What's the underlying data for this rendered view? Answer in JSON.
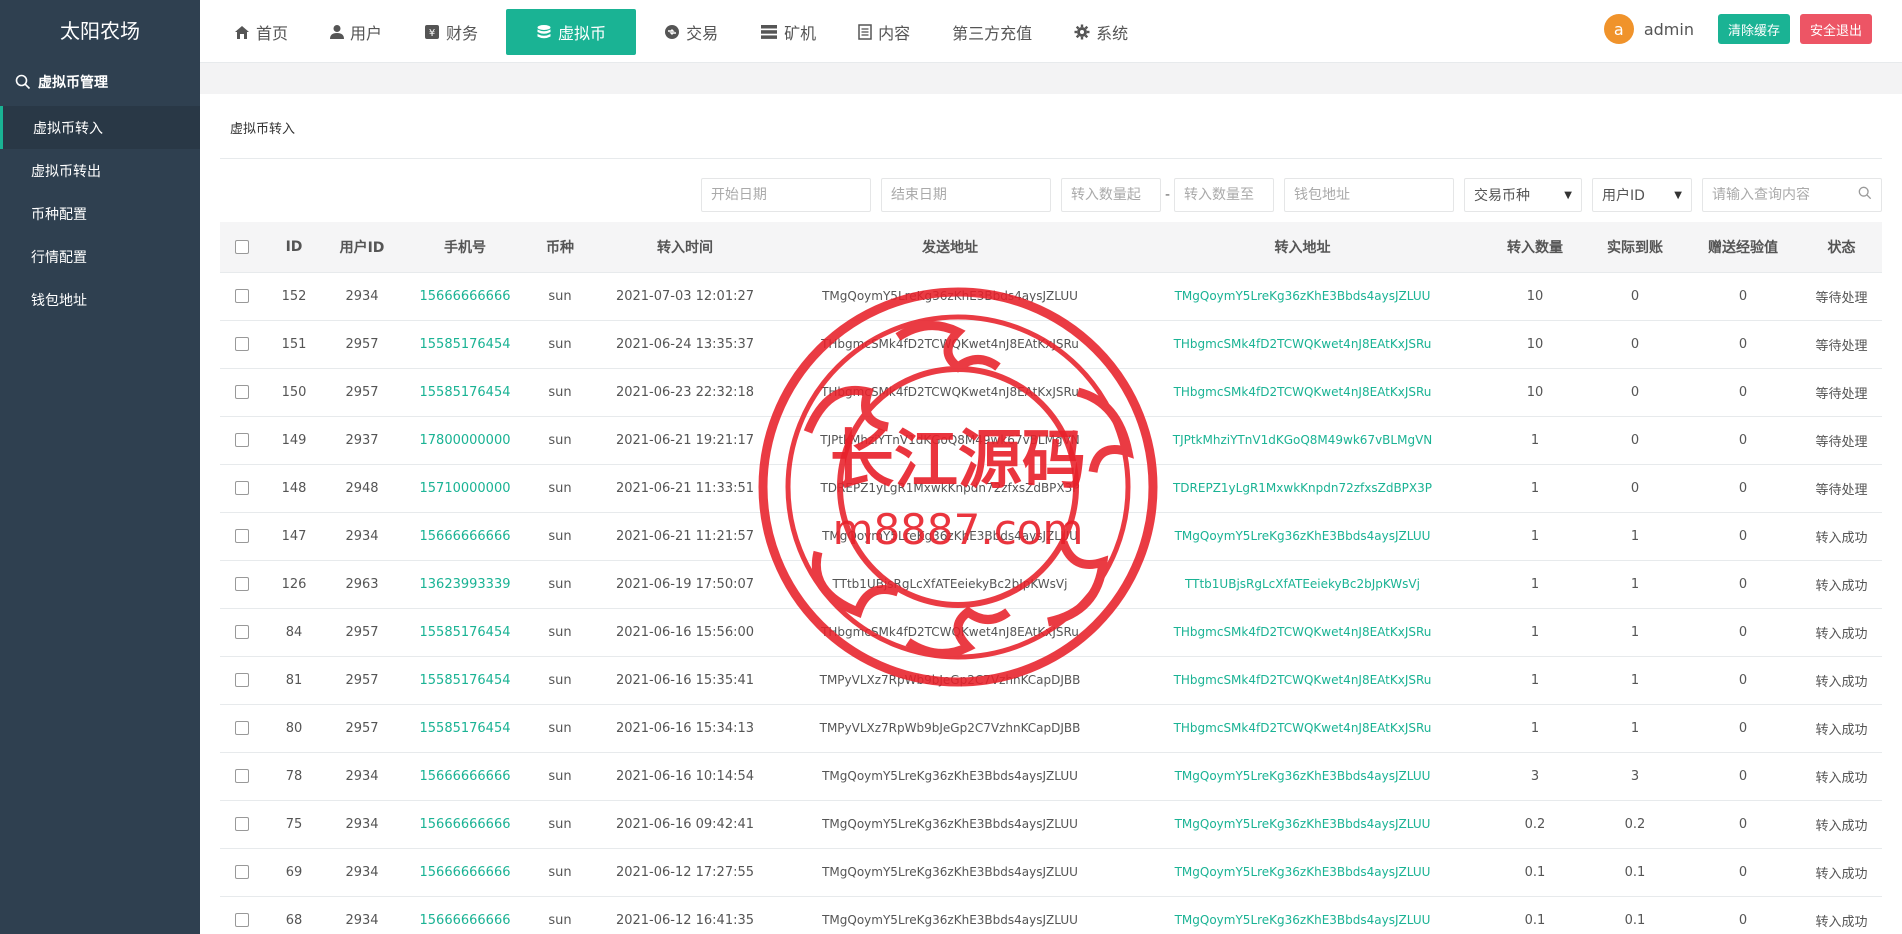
{
  "app": {
    "title": "太阳农场"
  },
  "sidebar": {
    "section": "虚拟币管理",
    "items": [
      {
        "label": "虚拟币转入",
        "active": true
      },
      {
        "label": "虚拟币转出",
        "active": false
      },
      {
        "label": "币种配置",
        "active": false
      },
      {
        "label": "行情配置",
        "active": false
      },
      {
        "label": "钱包地址",
        "active": false
      }
    ]
  },
  "topnav": {
    "items": [
      {
        "label": "首页",
        "icon": "home-icon"
      },
      {
        "label": "用户",
        "icon": "user-icon"
      },
      {
        "label": "财务",
        "icon": "money-icon"
      },
      {
        "label": "虚拟币",
        "icon": "database-icon",
        "active": true
      },
      {
        "label": "交易",
        "icon": "exchange-icon"
      },
      {
        "label": "矿机",
        "icon": "server-icon"
      },
      {
        "label": "内容",
        "icon": "document-icon"
      },
      {
        "label": "第三方充值",
        "icon": ""
      },
      {
        "label": "系统",
        "icon": "gear-icon"
      }
    ],
    "avatar_letter": "a",
    "admin_name": "admin",
    "clear_cache": "清除缓存",
    "logout": "安全退出"
  },
  "page": {
    "title": "虚拟币转入"
  },
  "filters": {
    "start_date": "开始日期",
    "end_date": "结束日期",
    "amount_from": "转入数量起",
    "dash": "-",
    "amount_to": "转入数量至",
    "wallet": "钱包地址",
    "coin_select": "交易币种",
    "field_select": "用户ID",
    "search": "请输入查询内容"
  },
  "table": {
    "headers": [
      "ID",
      "用户ID",
      "手机号",
      "币种",
      "转入时间",
      "发送地址",
      "转入地址",
      "转入数量",
      "实际到账",
      "赠送经验值",
      "状态"
    ],
    "rows": [
      [
        "152",
        "2934",
        "15666666666",
        "sun",
        "2021-07-03 12:01:27",
        "TMgQoymY5LreKg36zKhE3Bbds4aysJZLUU",
        "TMgQoymY5LreKg36zKhE3Bbds4aysJZLUU",
        "10",
        "0",
        "0",
        "等待处理"
      ],
      [
        "151",
        "2957",
        "15585176454",
        "sun",
        "2021-06-24 13:35:37",
        "THbgmcSMk4fD2TCWQKwet4nJ8EAtKxJSRu",
        "THbgmcSMk4fD2TCWQKwet4nJ8EAtKxJSRu",
        "10",
        "0",
        "0",
        "等待处理"
      ],
      [
        "150",
        "2957",
        "15585176454",
        "sun",
        "2021-06-23 22:32:18",
        "THbgmcSMk4fD2TCWQKwet4nJ8EAtKxJSRu",
        "THbgmcSMk4fD2TCWQKwet4nJ8EAtKxJSRu",
        "10",
        "0",
        "0",
        "等待处理"
      ],
      [
        "149",
        "2937",
        "17800000000",
        "sun",
        "2021-06-21 19:21:17",
        "TJPtkMhziYTnV1dKGoQ8M49wk67vBLMgVN",
        "TJPtkMhziYTnV1dKGoQ8M49wk67vBLMgVN",
        "1",
        "0",
        "0",
        "等待处理"
      ],
      [
        "148",
        "2948",
        "15710000000",
        "sun",
        "2021-06-21 11:33:51",
        "TDREPZ1yLgR1MxwkKnpdn72zfxsZdBPX3P",
        "TDREPZ1yLgR1MxwkKnpdn72zfxsZdBPX3P",
        "1",
        "0",
        "0",
        "等待处理"
      ],
      [
        "147",
        "2934",
        "15666666666",
        "sun",
        "2021-06-21 11:21:57",
        "TMgQoymY5LreKg36zKhE3Bbds4aysJZLUU",
        "TMgQoymY5LreKg36zKhE3Bbds4aysJZLUU",
        "1",
        "1",
        "0",
        "转入成功"
      ],
      [
        "126",
        "2963",
        "13623993339",
        "sun",
        "2021-06-19 17:50:07",
        "TTtb1UBjsRgLcXfATEeiekyBc2bJpKWsVj",
        "TTtb1UBjsRgLcXfATEeiekyBc2bJpKWsVj",
        "1",
        "1",
        "0",
        "转入成功"
      ],
      [
        "84",
        "2957",
        "15585176454",
        "sun",
        "2021-06-16 15:56:00",
        "THbgmcSMk4fD2TCWQKwet4nJ8EAtKxJSRu",
        "THbgmcSMk4fD2TCWQKwet4nJ8EAtKxJSRu",
        "1",
        "1",
        "0",
        "转入成功"
      ],
      [
        "81",
        "2957",
        "15585176454",
        "sun",
        "2021-06-16 15:35:41",
        "TMPyVLXz7RpWb9bJeGp2C7VzhnKCapDJBB",
        "THbgmcSMk4fD2TCWQKwet4nJ8EAtKxJSRu",
        "1",
        "1",
        "0",
        "转入成功"
      ],
      [
        "80",
        "2957",
        "15585176454",
        "sun",
        "2021-06-16 15:34:13",
        "TMPyVLXz7RpWb9bJeGp2C7VzhnKCapDJBB",
        "THbgmcSMk4fD2TCWQKwet4nJ8EAtKxJSRu",
        "1",
        "1",
        "0",
        "转入成功"
      ],
      [
        "78",
        "2934",
        "15666666666",
        "sun",
        "2021-06-16 10:14:54",
        "TMgQoymY5LreKg36zKhE3Bbds4aysJZLUU",
        "TMgQoymY5LreKg36zKhE3Bbds4aysJZLUU",
        "3",
        "3",
        "0",
        "转入成功"
      ],
      [
        "75",
        "2934",
        "15666666666",
        "sun",
        "2021-06-16 09:42:41",
        "TMgQoymY5LreKg36zKhE3Bbds4aysJZLUU",
        "TMgQoymY5LreKg36zKhE3Bbds4aysJZLUU",
        "0.2",
        "0.2",
        "0",
        "转入成功"
      ],
      [
        "69",
        "2934",
        "15666666666",
        "sun",
        "2021-06-12 17:27:55",
        "TMgQoymY5LreKg36zKhE3Bbds4aysJZLUU",
        "TMgQoymY5LreKg36zKhE3Bbds4aysJZLUU",
        "0.1",
        "0.1",
        "0",
        "转入成功"
      ],
      [
        "68",
        "2934",
        "15666666666",
        "sun",
        "2021-06-12 16:41:35",
        "TMgQoymY5LreKg36zKhE3Bbds4aysJZLUU",
        "TMgQoymY5LreKg36zKhE3Bbds4aysJZLUU",
        "0.1",
        "0.1",
        "0",
        "转入成功"
      ]
    ]
  },
  "watermark": {
    "line1": "长江源码",
    "line2": "m8887.com",
    "color": "#e8202a"
  },
  "colors": {
    "accent": "#1ab394",
    "danger": "#ed5565",
    "sidebar": "#2f4050"
  }
}
